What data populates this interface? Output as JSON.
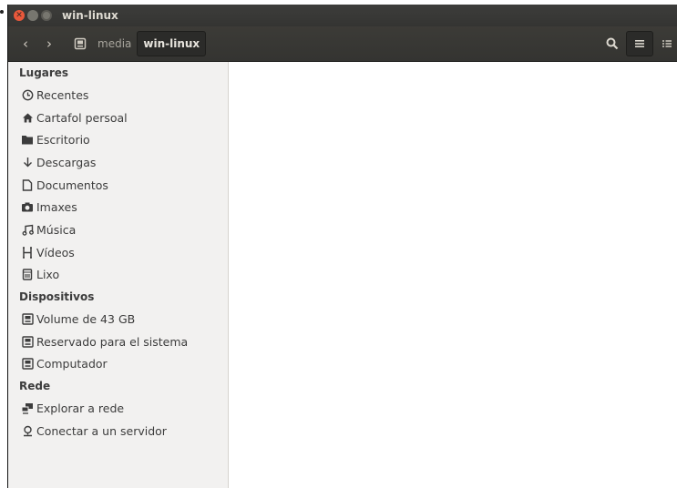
{
  "window": {
    "title": "win-linux"
  },
  "toolbar": {
    "back_label": "‹",
    "forward_label": "›",
    "breadcrumbs": [
      "media",
      "win-linux"
    ]
  },
  "sidebar": {
    "places_title": "Lugares",
    "places": [
      {
        "label": "Recentes",
        "icon": "clock-icon"
      },
      {
        "label": "Cartafol persoal",
        "icon": "home-icon"
      },
      {
        "label": "Escritorio",
        "icon": "desktop-folder-icon"
      },
      {
        "label": "Descargas",
        "icon": "download-icon"
      },
      {
        "label": "Documentos",
        "icon": "document-icon"
      },
      {
        "label": "Imaxes",
        "icon": "camera-icon"
      },
      {
        "label": "Música",
        "icon": "music-icon"
      },
      {
        "label": "Vídeos",
        "icon": "film-icon"
      },
      {
        "label": "Lixo",
        "icon": "trash-icon"
      }
    ],
    "devices_title": "Dispositivos",
    "devices": [
      {
        "label": "Volume de 43 GB",
        "icon": "drive-icon"
      },
      {
        "label": "Reservado para el sistema",
        "icon": "drive-icon"
      },
      {
        "label": "Computador",
        "icon": "drive-icon"
      }
    ],
    "network_title": "Rede",
    "network": [
      {
        "label": "Explorar a rede",
        "icon": "network-icon"
      },
      {
        "label": "Conectar a un servidor",
        "icon": "server-icon"
      }
    ]
  }
}
